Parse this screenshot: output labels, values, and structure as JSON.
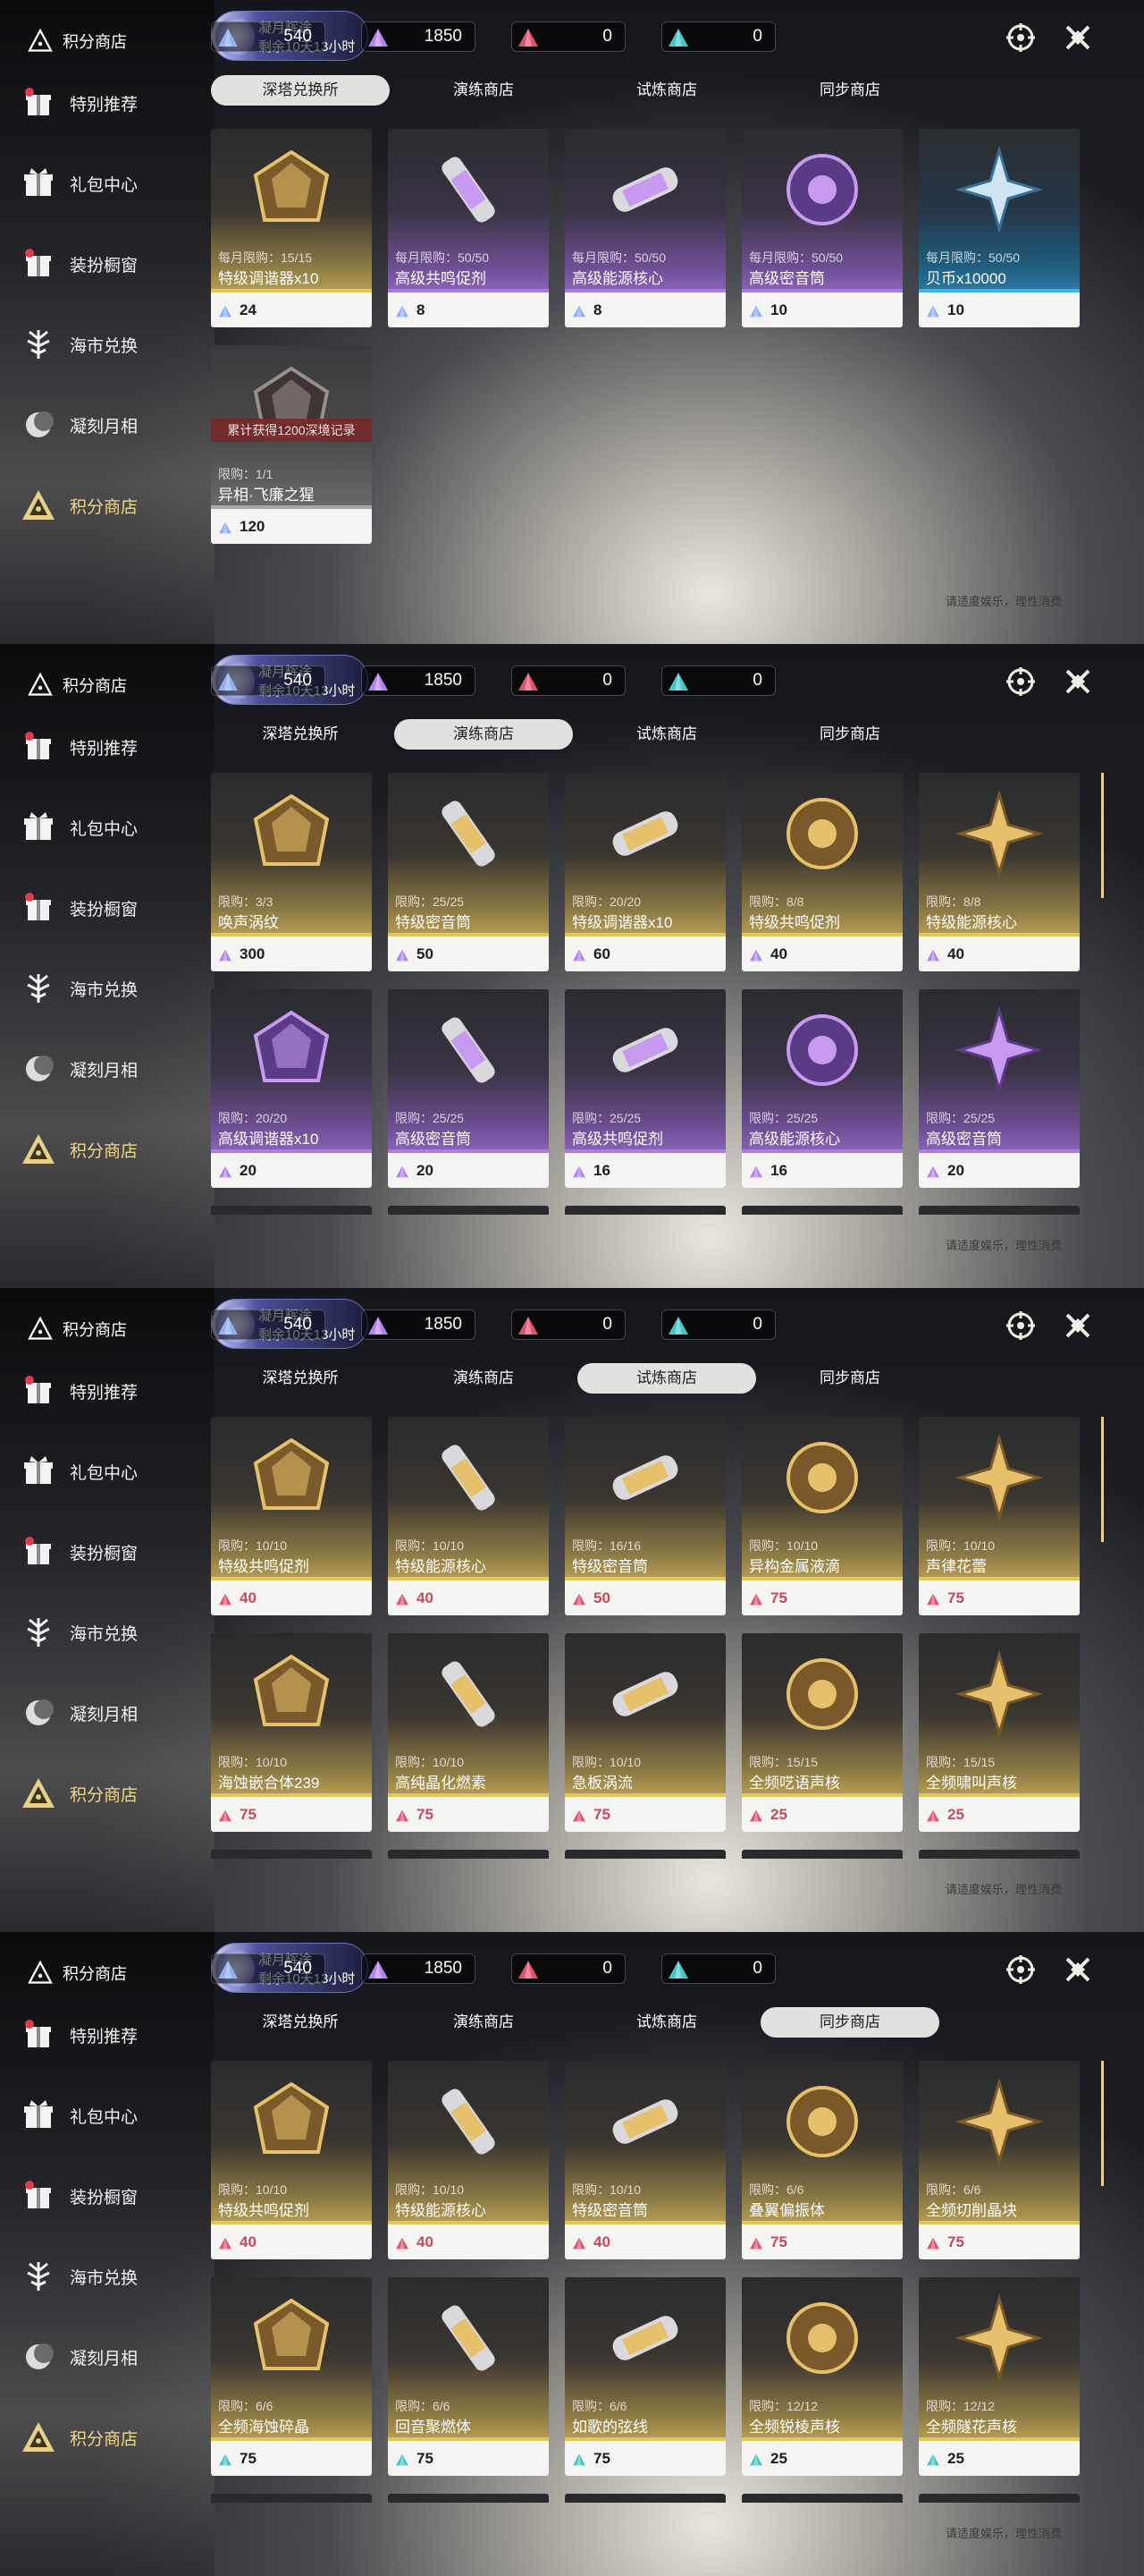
{
  "sidebar": {
    "title": "积分商店",
    "items": [
      {
        "label": "特别推荐",
        "icon": "gift-star-icon"
      },
      {
        "label": "礼包中心",
        "icon": "gift-box-icon"
      },
      {
        "label": "装扮橱窗",
        "icon": "gift-badge-icon"
      },
      {
        "label": "海市兑换",
        "icon": "tree-icon"
      },
      {
        "label": "凝刻月相",
        "icon": "moon-icon"
      },
      {
        "label": "积分商店",
        "icon": "triangle-emblem-icon"
      }
    ]
  },
  "event": {
    "title": "凝月辉途",
    "countdown": "剩余10天13小时"
  },
  "currencies": [
    {
      "value": "540",
      "color": "#8fb0ff"
    },
    {
      "value": "1850",
      "color": "#b282ee"
    },
    {
      "value": "0",
      "color": "#e0546d"
    },
    {
      "value": "0",
      "color": "#45c7c9"
    }
  ],
  "tabs": [
    "深塔兑换所",
    "演练商店",
    "试炼商店",
    "同步商店"
  ],
  "footnote": "请适度娱乐，理性消费",
  "panels": [
    {
      "selected_tab": 0,
      "cards": [
        {
          "limit": "每月限购：15/15",
          "name": "特级调谐器x10",
          "price": "24",
          "style": "gold",
          "gem": "blue"
        },
        {
          "limit": "每月限购：50/50",
          "name": "高级共鸣促剂",
          "price": "8",
          "style": "purple",
          "gem": "blue"
        },
        {
          "limit": "每月限购：50/50",
          "name": "高级能源核心",
          "price": "8",
          "style": "purple",
          "gem": "blue"
        },
        {
          "limit": "每月限购：50/50",
          "name": "高级密音筒",
          "price": "10",
          "style": "purple",
          "gem": "blue"
        },
        {
          "limit": "每月限购：50/50",
          "name": "贝币x10000",
          "price": "10",
          "style": "blue",
          "gem": "blue"
        },
        {
          "limit": "限购：1/1",
          "name": "异相·飞廉之猩",
          "price": "120",
          "style": "gray",
          "gem": "blue",
          "lock": "累计获得1200深境记录"
        }
      ]
    },
    {
      "selected_tab": 1,
      "cards": [
        {
          "limit": "限购：3/3",
          "name": "唤声涡纹",
          "price": "300",
          "style": "gold",
          "gem": "purple"
        },
        {
          "limit": "限购：25/25",
          "name": "特级密音筒",
          "price": "50",
          "style": "gold",
          "gem": "purple"
        },
        {
          "limit": "限购：20/20",
          "name": "特级调谐器x10",
          "price": "60",
          "style": "gold",
          "gem": "purple"
        },
        {
          "limit": "限购：8/8",
          "name": "特级共鸣促剂",
          "price": "40",
          "style": "gold",
          "gem": "purple"
        },
        {
          "limit": "限购：8/8",
          "name": "特级能源核心",
          "price": "40",
          "style": "gold",
          "gem": "purple"
        },
        {
          "limit": "限购：20/20",
          "name": "高级调谐器x10",
          "price": "20",
          "style": "purple",
          "gem": "purple"
        },
        {
          "limit": "限购：25/25",
          "name": "高级密音筒",
          "price": "20",
          "style": "purple",
          "gem": "purple"
        },
        {
          "limit": "限购：25/25",
          "name": "高级共鸣促剂",
          "price": "16",
          "style": "purple",
          "gem": "purple"
        },
        {
          "limit": "限购：25/25",
          "name": "高级能源核心",
          "price": "16",
          "style": "purple",
          "gem": "purple"
        },
        {
          "limit": "限购：25/25",
          "name": "高级密音筒",
          "price": "20",
          "style": "purple",
          "gem": "purple"
        }
      ]
    },
    {
      "selected_tab": 2,
      "cards": [
        {
          "limit": "限购：10/10",
          "name": "特级共鸣促剂",
          "price": "40",
          "style": "gold",
          "gem": "red"
        },
        {
          "limit": "限购：10/10",
          "name": "特级能源核心",
          "price": "40",
          "style": "gold",
          "gem": "red"
        },
        {
          "limit": "限购：16/16",
          "name": "特级密音筒",
          "price": "50",
          "style": "gold",
          "gem": "red"
        },
        {
          "limit": "限购：10/10",
          "name": "异构金属液滴",
          "price": "75",
          "style": "gold",
          "gem": "red"
        },
        {
          "limit": "限购：10/10",
          "name": "声律花蕾",
          "price": "75",
          "style": "gold",
          "gem": "red"
        },
        {
          "limit": "限购：10/10",
          "name": "海蚀嵌合体239",
          "price": "75",
          "style": "gold",
          "gem": "red"
        },
        {
          "limit": "限购：10/10",
          "name": "高纯晶化燃素",
          "price": "75",
          "style": "gold",
          "gem": "red"
        },
        {
          "limit": "限购：10/10",
          "name": "急板涡流",
          "price": "75",
          "style": "gold",
          "gem": "red"
        },
        {
          "limit": "限购：15/15",
          "name": "全频呓语声核",
          "price": "25",
          "style": "gold",
          "gem": "red"
        },
        {
          "limit": "限购：15/15",
          "name": "全频啸叫声核",
          "price": "25",
          "style": "gold",
          "gem": "red"
        }
      ]
    },
    {
      "selected_tab": 3,
      "cards": [
        {
          "limit": "限购：10/10",
          "name": "特级共鸣促剂",
          "price": "40",
          "style": "gold",
          "gem": "red"
        },
        {
          "limit": "限购：10/10",
          "name": "特级能源核心",
          "price": "40",
          "style": "gold",
          "gem": "red"
        },
        {
          "limit": "限购：10/10",
          "name": "特级密音筒",
          "price": "40",
          "style": "gold",
          "gem": "red"
        },
        {
          "limit": "限购：6/6",
          "name": "叠翼偏振体",
          "price": "75",
          "style": "gold",
          "gem": "red"
        },
        {
          "limit": "限购：6/6",
          "name": "全频切削晶块",
          "price": "75",
          "style": "gold",
          "gem": "red"
        },
        {
          "limit": "限购：6/6",
          "name": "全频海蚀碎晶",
          "price": "75",
          "style": "gold",
          "gem": "teal"
        },
        {
          "limit": "限购：6/6",
          "name": "回音聚燃体",
          "price": "75",
          "style": "gold",
          "gem": "teal"
        },
        {
          "limit": "限购：6/6",
          "name": "如歌的弦线",
          "price": "75",
          "style": "gold",
          "gem": "teal"
        },
        {
          "limit": "限购：12/12",
          "name": "全频锐棱声核",
          "price": "25",
          "style": "gold",
          "gem": "teal"
        },
        {
          "limit": "限购：12/12",
          "name": "全频隧花声核",
          "price": "25",
          "style": "gold",
          "gem": "teal"
        }
      ]
    }
  ]
}
